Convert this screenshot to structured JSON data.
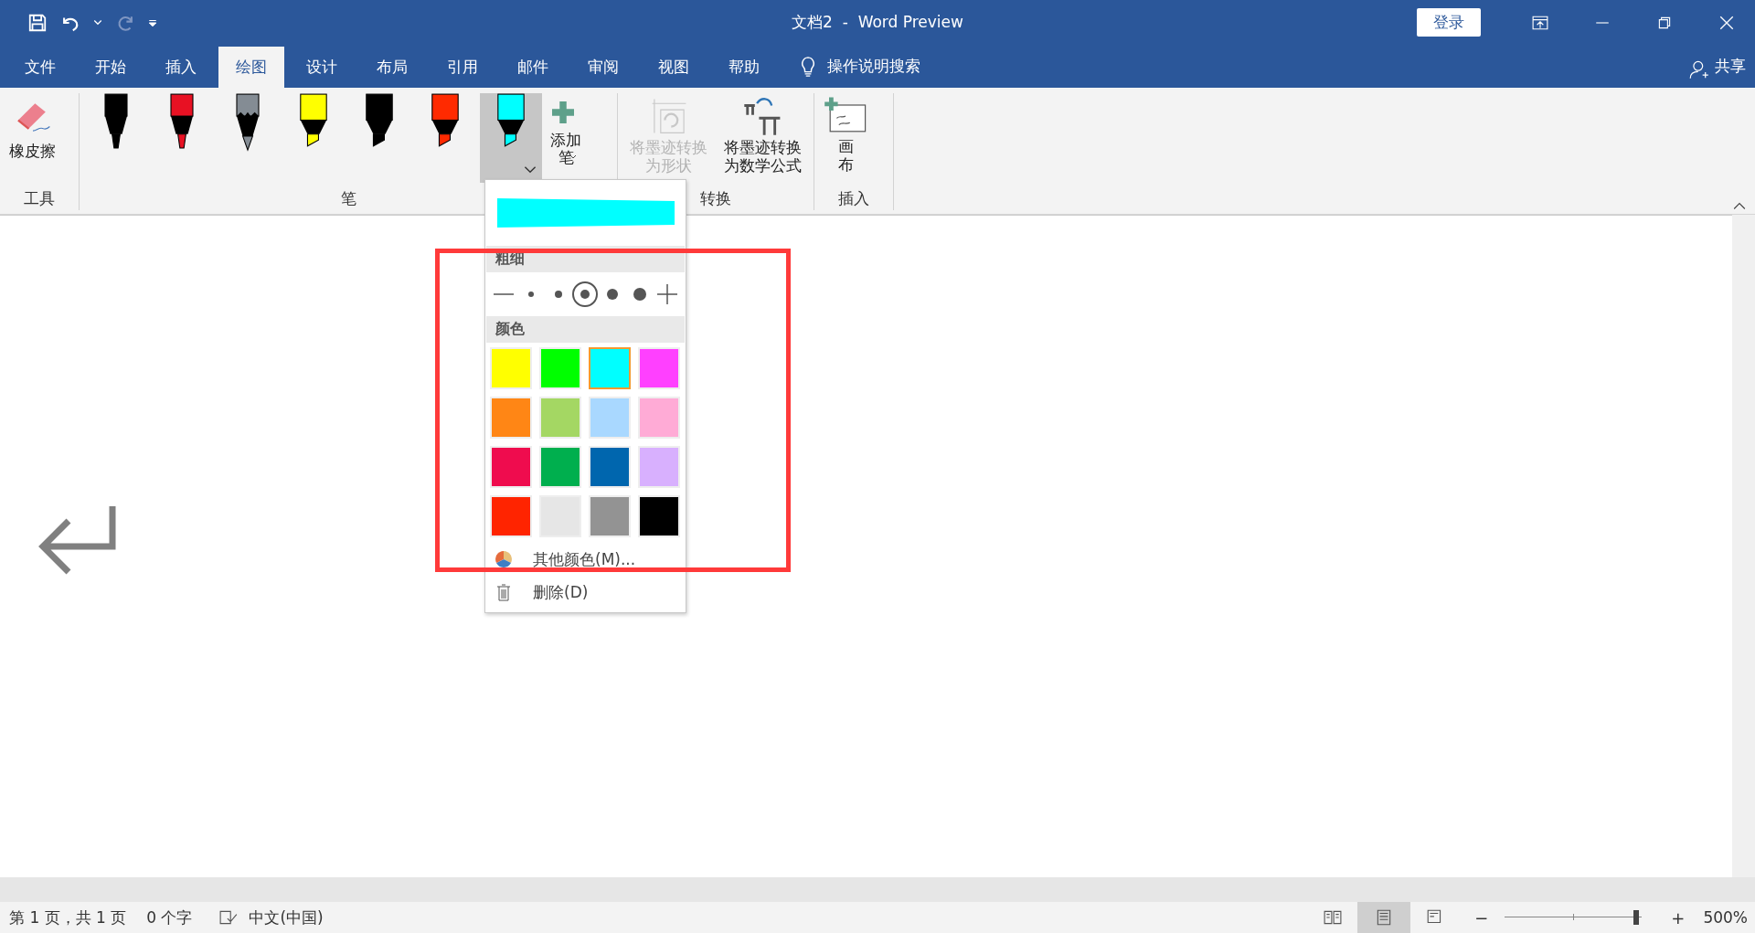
{
  "title_bar": {
    "title": "文档2  -  Word Preview",
    "login": "登录"
  },
  "tabs": [
    {
      "label": "文件",
      "selected": false
    },
    {
      "label": "开始",
      "selected": false
    },
    {
      "label": "插入",
      "selected": false
    },
    {
      "label": "绘图",
      "selected": true
    },
    {
      "label": "设计",
      "selected": false
    },
    {
      "label": "布局",
      "selected": false
    },
    {
      "label": "引用",
      "selected": false
    },
    {
      "label": "邮件",
      "selected": false
    },
    {
      "label": "审阅",
      "selected": false
    },
    {
      "label": "视图",
      "selected": false
    },
    {
      "label": "帮助",
      "selected": false
    }
  ],
  "search": "操作说明搜索",
  "share": "共享",
  "ribbon": {
    "tools": {
      "label": "工具",
      "eraser": "橡皮擦"
    },
    "pens": {
      "label": "笔",
      "add_pen": "添加笔",
      "items": [
        {
          "kind": "pen",
          "color": "#000000",
          "selected": false
        },
        {
          "kind": "pen",
          "color": "#e81123",
          "selected": false
        },
        {
          "kind": "pencil",
          "color": "#848c94",
          "selected": false
        },
        {
          "kind": "highlighter",
          "color": "#ffff00",
          "selected": false
        },
        {
          "kind": "highlighter",
          "color": "#000000",
          "selected": false
        },
        {
          "kind": "highlighter",
          "color": "#ff2a00",
          "selected": false
        },
        {
          "kind": "highlighter",
          "color": "#00ffff",
          "selected": true
        }
      ]
    },
    "convert": {
      "label": "转换",
      "buttons": [
        {
          "label": "将墨迹转换为形状",
          "disabled": true,
          "kind": "shape"
        },
        {
          "label": "将墨迹转换为数学公式",
          "disabled": false,
          "kind": "math"
        }
      ]
    },
    "insert": {
      "label": "插入",
      "canvas": "画布"
    }
  },
  "pen_menu": {
    "thickness_label": "粗细",
    "thickness": [
      {
        "kind": "thinner",
        "selected": false
      },
      {
        "kind": "dot",
        "selected": false
      },
      {
        "kind": "dot",
        "selected": false
      },
      {
        "kind": "dot",
        "selected": true
      },
      {
        "kind": "dot",
        "selected": false
      },
      {
        "kind": "dot",
        "selected": false
      },
      {
        "kind": "thicker",
        "selected": false
      }
    ],
    "color_label": "颜色",
    "colors": [
      {
        "color": "#ffff00",
        "selected": false
      },
      {
        "color": "#00ff00",
        "selected": false
      },
      {
        "color": "#00ffff",
        "selected": true
      },
      {
        "color": "#ff40ff",
        "selected": false
      },
      {
        "color": "#ff8615",
        "selected": false
      },
      {
        "color": "#a4d763",
        "selected": false
      },
      {
        "color": "#a9d8ff",
        "selected": false
      },
      {
        "color": "#ffabd6",
        "selected": false
      },
      {
        "color": "#ef0c4e",
        "selected": false
      },
      {
        "color": "#00af4e",
        "selected": false
      },
      {
        "color": "#0066ae",
        "selected": false
      },
      {
        "color": "#d8b0fe",
        "selected": false
      },
      {
        "color": "#ff2400",
        "selected": false
      },
      {
        "color": "#e6e6e6",
        "selected": false
      },
      {
        "color": "#939393",
        "selected": false
      },
      {
        "color": "#000000",
        "selected": false
      }
    ],
    "more_colors": "其他颜色(M)...",
    "delete": "删除(D)"
  },
  "highlight_frame": true,
  "status_bar": {
    "page": "第 1 页，共 1 页",
    "words": "0 个字",
    "language": "中文(中国)",
    "views": [
      {
        "kind": "read",
        "selected": false
      },
      {
        "kind": "print",
        "selected": true
      },
      {
        "kind": "web",
        "selected": false
      }
    ],
    "zoom_minus": "−",
    "zoom_plus": "+",
    "zoom": {
      "level": 0.96
    },
    "zoom_label": "500%"
  }
}
